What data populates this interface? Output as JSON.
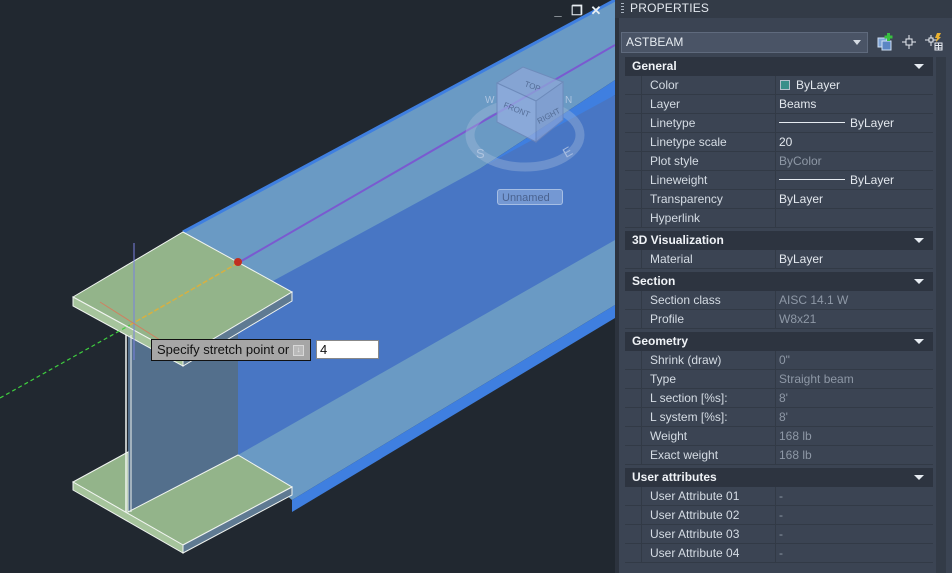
{
  "viewport": {
    "window_controls": {
      "minimize": "_",
      "restore": "❐",
      "close": "✕"
    },
    "viewcube": {
      "top": "TOP",
      "front": "FRONT",
      "right": "RIGHT",
      "compass": [
        "W",
        "N",
        "S",
        "E"
      ]
    },
    "named_view": "Unnamed",
    "command_prompt": "Specify stretch point or",
    "prompt_more_icon": "down-arrow-icon",
    "dynamic_input_value": "4",
    "colors": {
      "flange": "#93b48a",
      "selection": "#4a7fcf",
      "background": "#212830"
    }
  },
  "panel": {
    "title": "PROPERTIES",
    "selected_object": "ASTBEAM",
    "toolbar": [
      {
        "name": "quick-select-icon",
        "label": "Quick Select"
      },
      {
        "name": "select-objects-icon",
        "label": "Select Objects"
      },
      {
        "name": "toggle-pickadd-icon",
        "label": "Toggle PICKADD"
      }
    ],
    "categories": [
      {
        "title": "General",
        "rows": [
          {
            "name": "Color",
            "value": "ByLayer",
            "kind": "swatch",
            "swatch": "#3a8f8a"
          },
          {
            "name": "Layer",
            "value": "Beams"
          },
          {
            "name": "Linetype",
            "value": "ByLayer",
            "kind": "line"
          },
          {
            "name": "Linetype scale",
            "value": "20"
          },
          {
            "name": "Plot style",
            "value": "ByColor",
            "dim": true
          },
          {
            "name": "Lineweight",
            "value": "ByLayer",
            "kind": "line"
          },
          {
            "name": "Transparency",
            "value": "ByLayer"
          },
          {
            "name": "Hyperlink",
            "value": ""
          }
        ]
      },
      {
        "title": "3D Visualization",
        "rows": [
          {
            "name": "Material",
            "value": "ByLayer"
          }
        ]
      },
      {
        "title": "Section",
        "rows": [
          {
            "name": "Section class",
            "value": "AISC 14.1 W",
            "dim": true
          },
          {
            "name": "Profile",
            "value": "W8x21",
            "dim": true
          }
        ]
      },
      {
        "title": "Geometry",
        "rows": [
          {
            "name": "Shrink (draw)",
            "value": "0\"",
            "dim": true
          },
          {
            "name": "Type",
            "value": "Straight beam",
            "dim": true
          },
          {
            "name": "L section [%s]:",
            "value": "8'",
            "dim": true
          },
          {
            "name": "L system [%s]:",
            "value": "8'",
            "dim": true
          },
          {
            "name": "Weight",
            "value": "168 lb",
            "dim": true
          },
          {
            "name": "Exact weight",
            "value": "168 lb",
            "dim": true
          }
        ]
      },
      {
        "title": "User attributes",
        "rows": [
          {
            "name": "User Attribute 01",
            "value": "-",
            "dim": true
          },
          {
            "name": "User Attribute 02",
            "value": "-",
            "dim": true
          },
          {
            "name": "User Attribute 03",
            "value": "-",
            "dim": true
          },
          {
            "name": "User Attribute 04",
            "value": "-",
            "dim": true
          }
        ]
      }
    ]
  }
}
